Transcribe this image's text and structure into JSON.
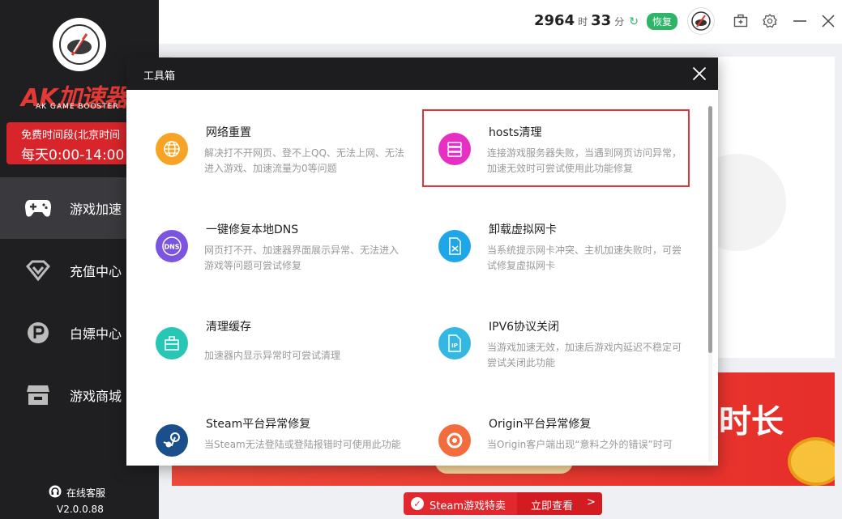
{
  "sidebar": {
    "brand": "AK加速器",
    "brand_sub": "AK GAME BOOSTER",
    "free_line1": "免费时间段(北京时间",
    "free_line2": "每天0:00-14:00",
    "nav": [
      {
        "label": "游戏加速",
        "icon": "gamepad-icon"
      },
      {
        "label": "充值中心",
        "icon": "diamond-icon"
      },
      {
        "label": "白嫖中心",
        "icon": "parking-icon"
      },
      {
        "label": "游戏商城",
        "icon": "store-icon"
      }
    ],
    "service": "在线客服",
    "version": "V2.0.0.88"
  },
  "topbar": {
    "hours": "2964",
    "hours_unit": "时",
    "minutes": "33",
    "minutes_unit": "分",
    "restore": "恢复"
  },
  "banner": {
    "text": "时长",
    "steam_text": "Steam游戏特卖",
    "steam_link": "立即查看",
    "arrow": ">"
  },
  "dialog": {
    "title": "工具箱",
    "tools": [
      {
        "title": "网络重置",
        "desc": "解决打不开网页、登不上QQ、无法上网、无法进入游戏、加速流量为0等问题",
        "icon": "globe-icon",
        "color": "#f7a325"
      },
      {
        "title": "hosts清理",
        "desc": "连接游戏服务器失败，当遇到网页访问异常，加速无效时可尝试使用此功能修复",
        "icon": "server-icon",
        "color": "#e62fc3"
      },
      {
        "title": "一键修复本地DNS",
        "desc": "网页打不开、加速器界面展示异常、无法进入游戏等问题可尝试修复",
        "icon": "dns-icon",
        "color": "#7b55e0",
        "badge": "DNS"
      },
      {
        "title": "卸载虚拟网卡",
        "desc": "当系统提示网卡冲突、主机加速失败时，可尝试修复虚拟网卡",
        "icon": "sim-card-icon",
        "color": "#1fa6e8"
      },
      {
        "title": "清理缓存",
        "desc": "加速器内显示异常时可尝试清理",
        "icon": "briefcase-icon",
        "color": "#28c6b4"
      },
      {
        "title": "IPV6协议关闭",
        "desc": "当游戏加速无效，加速后游戏内延迟不稳定可尝试关闭此功能",
        "icon": "ip-file-icon",
        "color": "#34b8e3",
        "badge": "IP"
      },
      {
        "title": "Steam平台异常修复",
        "desc": "当Steam无法登陆或登陆报错时可使用此功能",
        "icon": "steam-icon",
        "color": "#1b4f8c"
      },
      {
        "title": "Origin平台异常修复",
        "desc": "当Origin客户端出现“意料之外的错误”时可",
        "icon": "origin-icon",
        "color": "#f26d3d"
      }
    ]
  }
}
